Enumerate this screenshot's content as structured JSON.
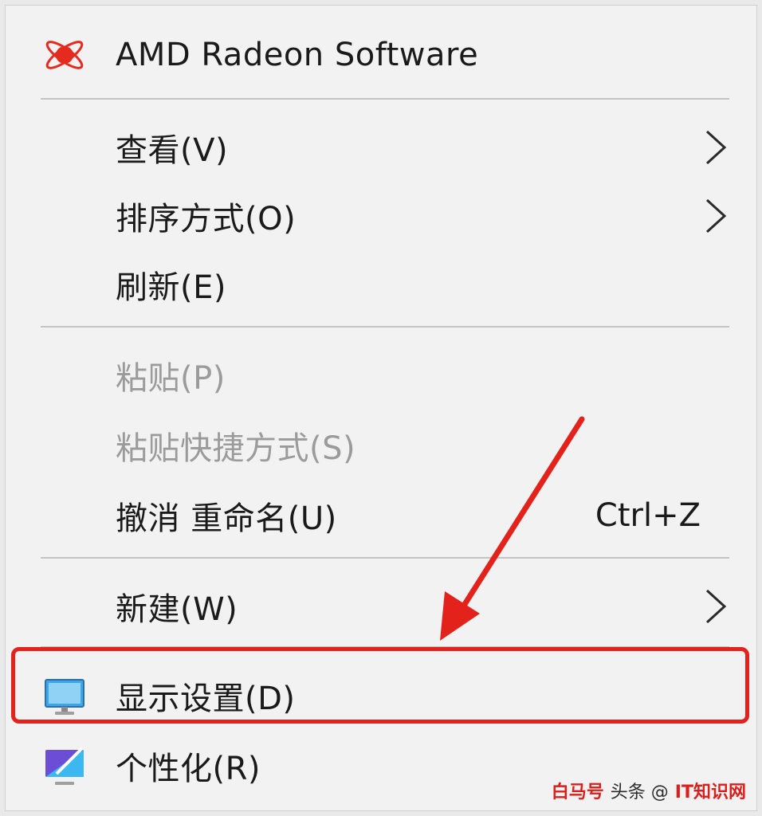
{
  "menu": {
    "items": [
      {
        "label": "AMD Radeon Software",
        "icon": "amd-radeon-icon"
      },
      {
        "label": "查看(V)",
        "submenu": true
      },
      {
        "label": "排序方式(O)",
        "submenu": true
      },
      {
        "label": "刷新(E)"
      },
      {
        "label": "粘贴(P)",
        "disabled": true
      },
      {
        "label": "粘贴快捷方式(S)",
        "disabled": true
      },
      {
        "label": "撤消 重命名(U)",
        "shortcut": "Ctrl+Z"
      },
      {
        "label": "新建(W)",
        "submenu": true
      },
      {
        "label": "显示设置(D)",
        "icon": "monitor-icon",
        "highlighted": true
      },
      {
        "label": "个性化(R)",
        "icon": "personalize-icon"
      }
    ]
  },
  "annotation": {
    "color": "#e3221c"
  },
  "watermark": {
    "left": "白马号",
    "middle": "头条 @",
    "right": "IT知识网"
  }
}
